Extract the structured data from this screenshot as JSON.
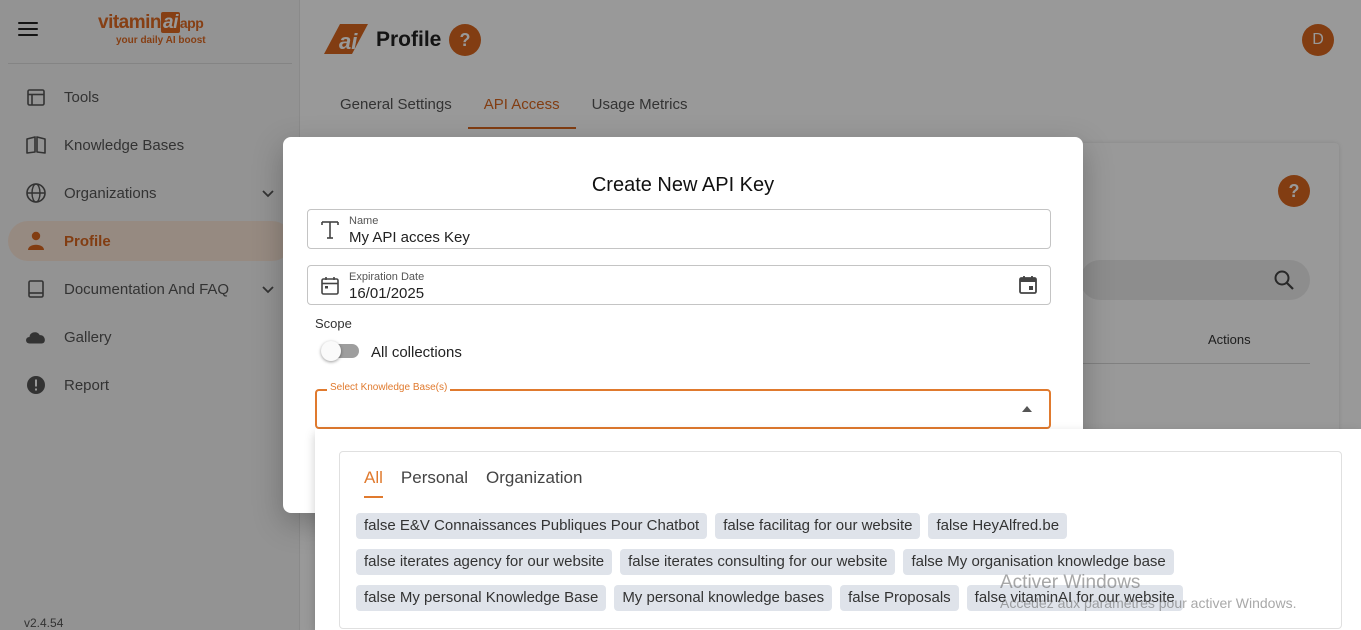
{
  "sidebar": {
    "logo": {
      "text_main": "vitamin",
      "text_ai": "ai",
      "text_app": "app",
      "tagline": "your daily AI boost"
    },
    "items": [
      {
        "label": "Tools",
        "icon": "calendar-icon"
      },
      {
        "label": "Knowledge Bases",
        "icon": "book-icon"
      },
      {
        "label": "Organizations",
        "icon": "globe-icon"
      },
      {
        "label": "Profile",
        "icon": "person-icon"
      },
      {
        "label": "Documentation And FAQ",
        "icon": "document-icon"
      },
      {
        "label": "Gallery",
        "icon": "cloud-icon"
      },
      {
        "label": "Report",
        "icon": "alert-icon"
      }
    ],
    "version": "v2.4.54"
  },
  "header": {
    "title": "Profile",
    "help": "?",
    "avatar_letter": "D"
  },
  "tabs": [
    "General Settings",
    "API Access",
    "Usage Metrics"
  ],
  "background": {
    "help": "?",
    "column_actions": "Actions"
  },
  "dialog": {
    "title": "Create New API Key",
    "name_label": "Name",
    "name_value": "My API acces Key",
    "date_label": "Expiration Date",
    "date_value": "16/01/2025",
    "scope_label": "Scope",
    "all_collections_label": "All collections",
    "select_label": "Select Knowledge Base(s)"
  },
  "dropdown": {
    "tabs": [
      "All",
      "Personal",
      "Organization"
    ],
    "chips": [
      "false E&V Connaissances Publiques Pour Chatbot",
      "false facilitag for our website",
      "false HeyAlfred.be",
      "false iterates agency for our website",
      "false iterates consulting for our website",
      "false My organisation knowledge base",
      "false My personal Knowledge Base",
      "My personal knowledge bases",
      "false Proposals",
      "false vitaminAI for our website"
    ]
  },
  "watermark": {
    "title": "Activer Windows",
    "subtitle": "Accédez aux paramètres pour activer Windows."
  },
  "colors": {
    "accent": "#d9661f",
    "active_bg": "#fbe6d8",
    "chip_bg": "#dfe3ea"
  }
}
